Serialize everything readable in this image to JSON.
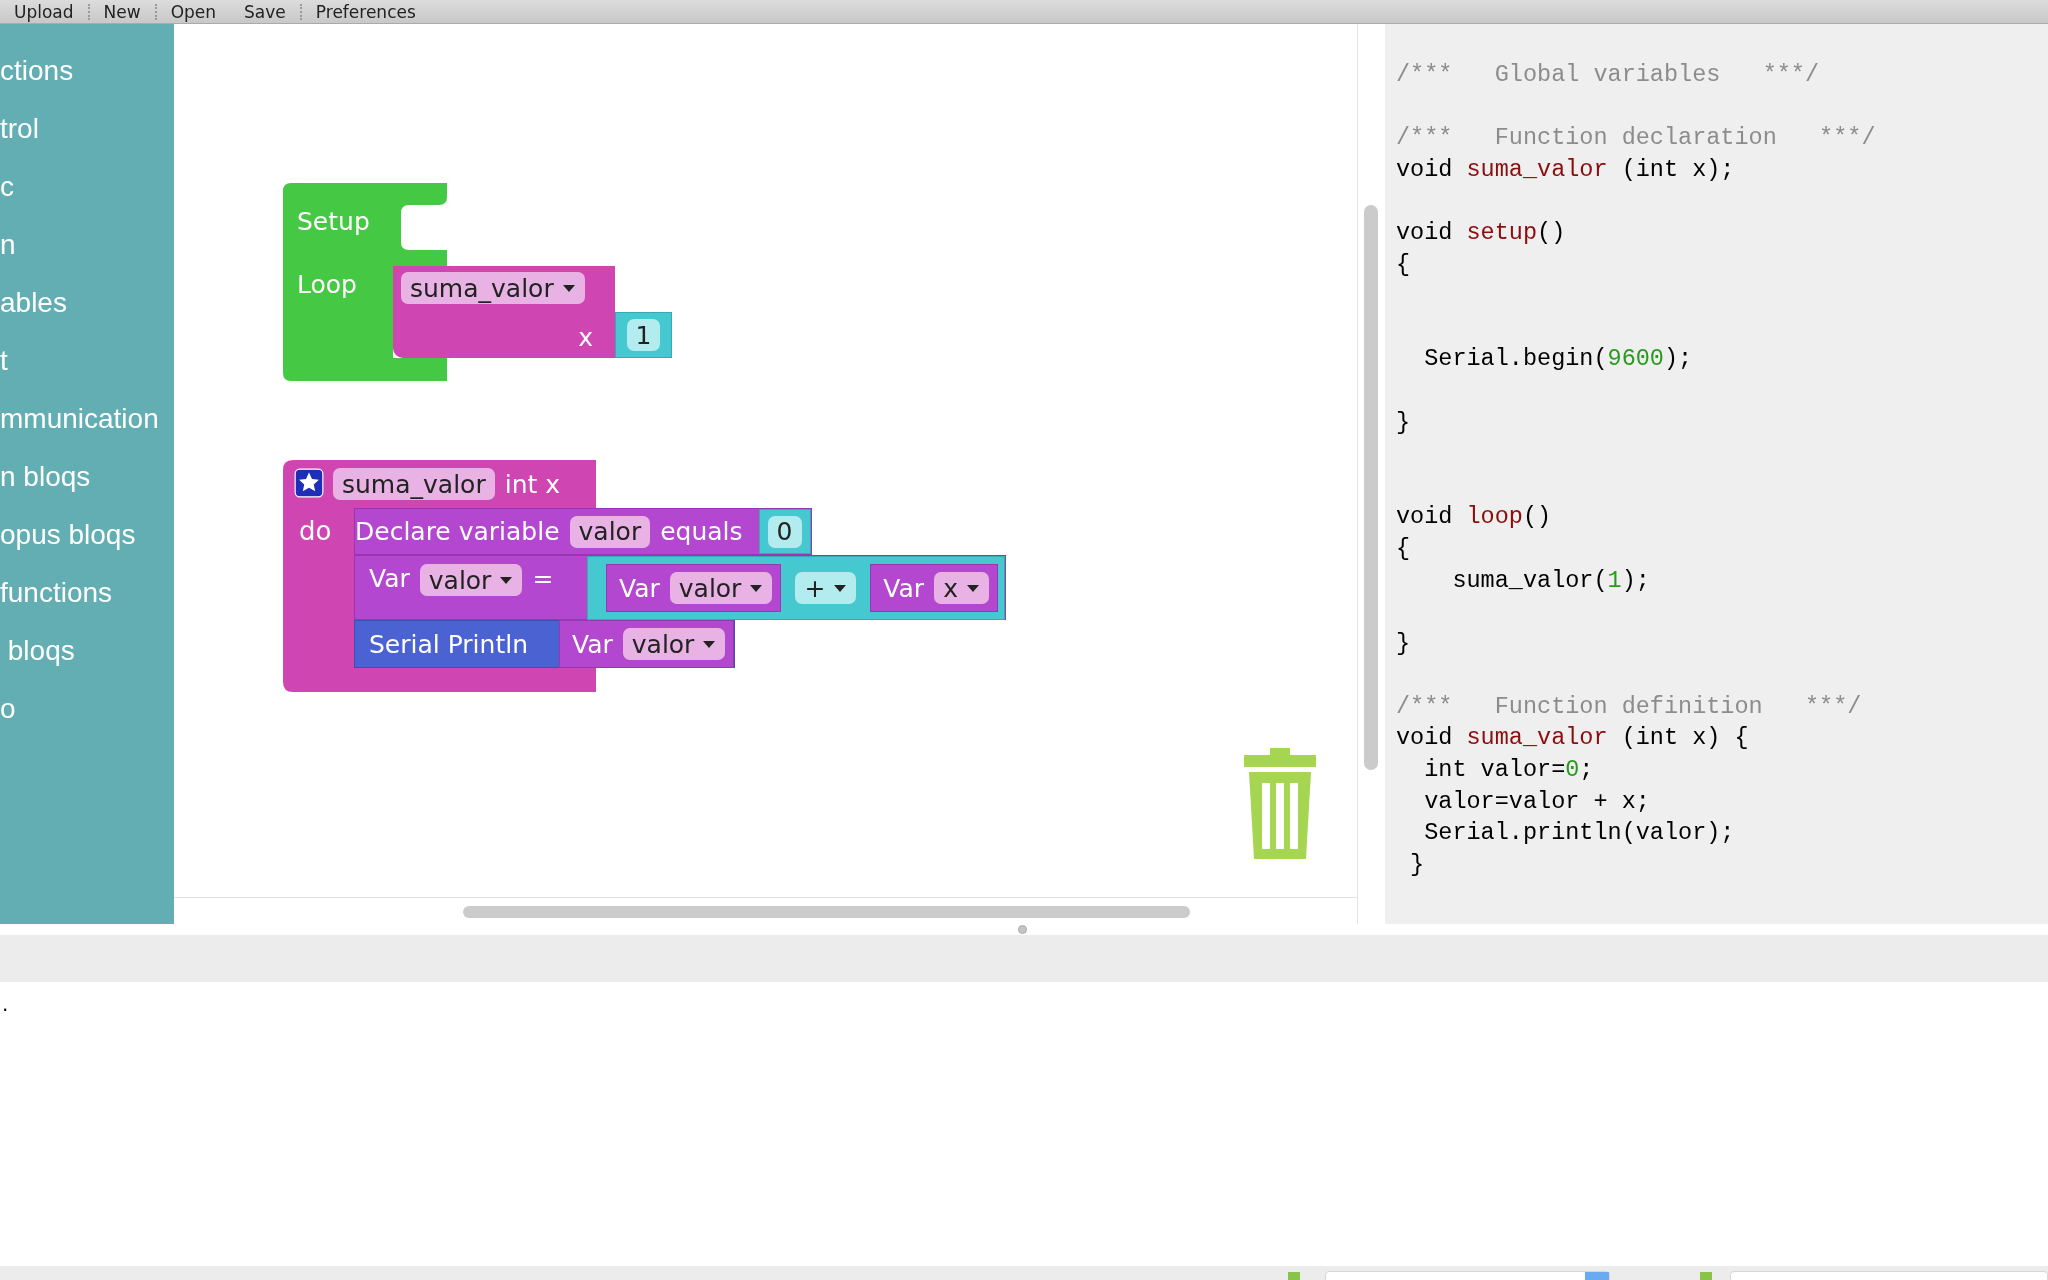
{
  "toolbar": {
    "buttons": [
      "Upload",
      "New",
      "Open",
      "Save",
      "Preferences"
    ]
  },
  "sidebar": {
    "items": [
      {
        "label": "ctions"
      },
      {
        "label": "trol"
      },
      {
        "label": "c"
      },
      {
        "label": "n"
      },
      {
        "label": "ables"
      },
      {
        "label": "t"
      },
      {
        "label": "mmunication"
      },
      {
        "label": "n bloqs"
      },
      {
        "label": "opus bloqs"
      },
      {
        "label": "functions"
      },
      {
        "label": " bloqs"
      },
      {
        "label": "o"
      }
    ]
  },
  "workspace": {
    "setup_block": {
      "setup_label": "Setup",
      "loop_label": "Loop",
      "call": {
        "name": "suma_valor",
        "param_label": "x",
        "value": "1"
      }
    },
    "function_block": {
      "name": "suma_valor",
      "params": "int x",
      "do_label": "do",
      "statements": [
        {
          "kind": "declare",
          "label": "Declare variable",
          "var": "valor",
          "equals": "equals",
          "value": "0"
        },
        {
          "kind": "assign",
          "var_label": "Var",
          "var": "valor",
          "op": "=",
          "left": {
            "var_label": "Var",
            "var": "valor"
          },
          "operator": "+",
          "right": {
            "var_label": "Var",
            "var": "x"
          }
        },
        {
          "kind": "println",
          "label": "Serial Println",
          "arg": {
            "var_label": "Var",
            "var": "valor"
          }
        }
      ]
    }
  },
  "code": {
    "lines": [
      {
        "kind": "code",
        "segments": [
          {
            "kind": "comment",
            "text": "/***   Global variables   ***/"
          }
        ]
      },
      {
        "kind": "blank"
      },
      {
        "kind": "code",
        "segments": [
          {
            "kind": "comment",
            "text": "/***   Function declaration   ***/"
          }
        ]
      },
      {
        "kind": "code",
        "segments": [
          {
            "kind": "plain",
            "text": "void "
          },
          {
            "kind": "function",
            "text": "suma_valor"
          },
          {
            "kind": "plain",
            "text": " (int x);"
          }
        ]
      },
      {
        "kind": "blank"
      },
      {
        "kind": "code",
        "segments": [
          {
            "kind": "plain",
            "text": "void "
          },
          {
            "kind": "function",
            "text": "setup"
          },
          {
            "kind": "plain",
            "text": "()"
          }
        ]
      },
      {
        "kind": "code",
        "segments": [
          {
            "kind": "plain",
            "text": "{"
          }
        ]
      },
      {
        "kind": "blank"
      },
      {
        "kind": "blank"
      },
      {
        "kind": "code",
        "segments": [
          {
            "kind": "plain",
            "text": "  Serial.begin("
          },
          {
            "kind": "number",
            "text": "9600"
          },
          {
            "kind": "plain",
            "text": ");"
          }
        ]
      },
      {
        "kind": "blank"
      },
      {
        "kind": "code",
        "segments": [
          {
            "kind": "plain",
            "text": "}"
          }
        ]
      },
      {
        "kind": "blank"
      },
      {
        "kind": "blank"
      },
      {
        "kind": "code",
        "segments": [
          {
            "kind": "plain",
            "text": "void "
          },
          {
            "kind": "function",
            "text": "loop"
          },
          {
            "kind": "plain",
            "text": "()"
          }
        ]
      },
      {
        "kind": "code",
        "segments": [
          {
            "kind": "plain",
            "text": "{"
          }
        ]
      },
      {
        "kind": "code",
        "segments": [
          {
            "kind": "plain",
            "text": "    suma_valor("
          },
          {
            "kind": "number",
            "text": "1"
          },
          {
            "kind": "plain",
            "text": ");"
          }
        ]
      },
      {
        "kind": "blank"
      },
      {
        "kind": "code",
        "segments": [
          {
            "kind": "plain",
            "text": "}"
          }
        ]
      },
      {
        "kind": "blank"
      },
      {
        "kind": "code",
        "segments": [
          {
            "kind": "comment",
            "text": "/***   Function definition   ***/"
          }
        ]
      },
      {
        "kind": "code",
        "segments": [
          {
            "kind": "plain",
            "text": "void "
          },
          {
            "kind": "function",
            "text": "suma_valor"
          },
          {
            "kind": "plain",
            "text": " (int x) {"
          }
        ]
      },
      {
        "kind": "code",
        "segments": [
          {
            "kind": "plain",
            "text": "  int valor="
          },
          {
            "kind": "number",
            "text": "0"
          },
          {
            "kind": "plain",
            "text": ";"
          }
        ]
      },
      {
        "kind": "code",
        "segments": [
          {
            "kind": "plain",
            "text": "  valor=valor + x;"
          }
        ]
      },
      {
        "kind": "code",
        "segments": [
          {
            "kind": "plain",
            "text": "  Serial.println(valor);"
          }
        ]
      },
      {
        "kind": "code",
        "segments": [
          {
            "kind": "plain",
            "text": " }"
          }
        ]
      }
    ]
  },
  "console": {
    "output": "."
  }
}
